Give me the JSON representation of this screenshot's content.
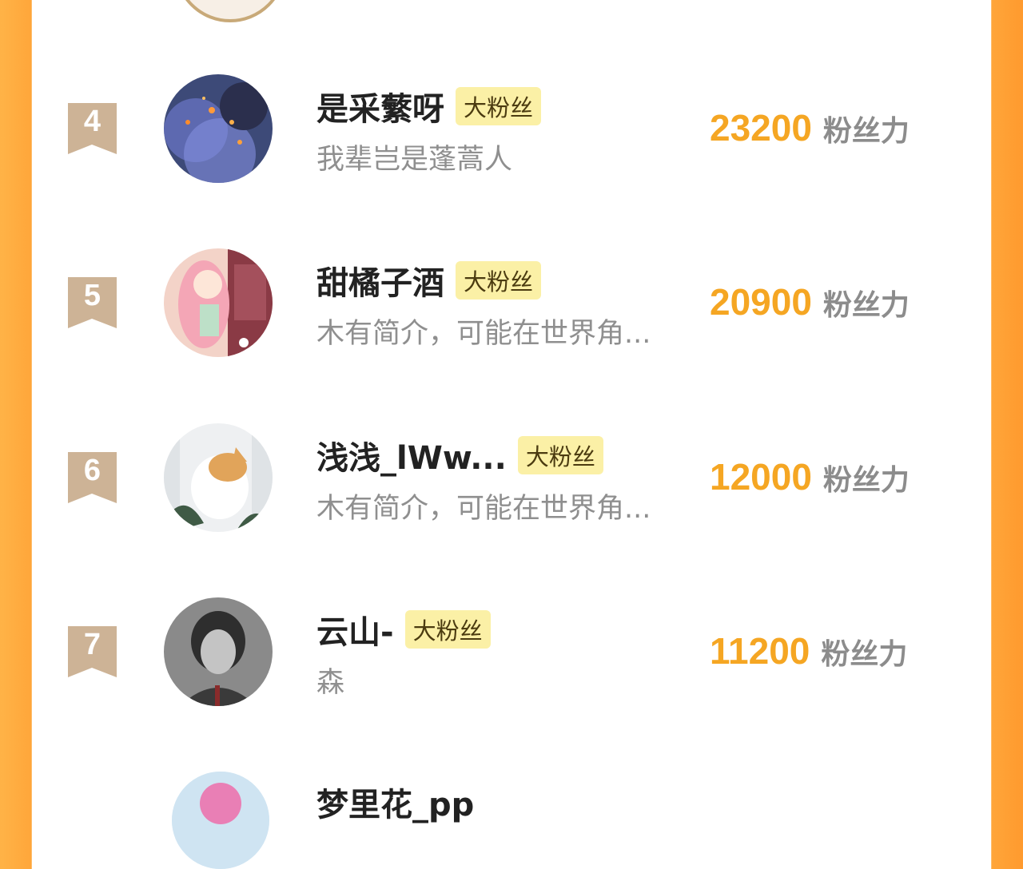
{
  "ranking": {
    "items": [
      {
        "rank": "4",
        "name": "是采蘩呀",
        "badge": "大粉丝",
        "bio": "我辈岂是蓬蒿人",
        "score": "23200",
        "unit": "粉丝力"
      },
      {
        "rank": "5",
        "name": "甜橘子酒",
        "badge": "大粉丝",
        "bio": "木有简介，可能在世界角...",
        "score": "20900",
        "unit": "粉丝力"
      },
      {
        "rank": "6",
        "name": "浅浅_lWw...",
        "badge": "大粉丝",
        "bio": "木有简介，可能在世界角...",
        "score": "12000",
        "unit": "粉丝力"
      },
      {
        "rank": "7",
        "name": "云山-",
        "badge": "大粉丝",
        "bio": "森",
        "score": "11200",
        "unit": "粉丝力"
      }
    ],
    "partial_next_name": "梦里花_pp"
  },
  "colors": {
    "accent": "#f5a623",
    "badge_bg": "#fbf0a6",
    "rank_tag": "#c9ad8c",
    "side_gradient": "#ffa63a"
  },
  "icons": {
    "rank_tag": "ribbon-tag-icon"
  }
}
